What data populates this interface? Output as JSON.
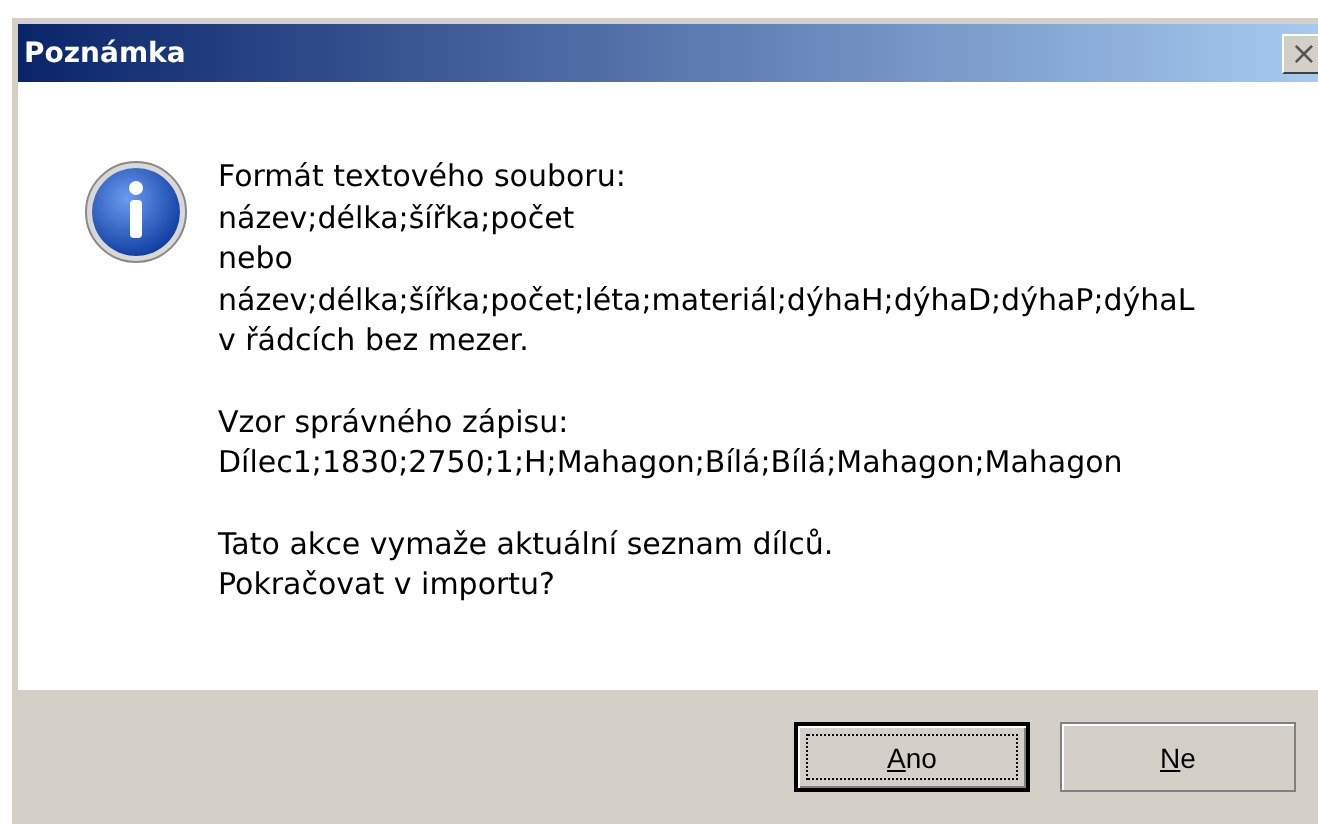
{
  "window": {
    "title": "Poznámka",
    "close_label": "×"
  },
  "message": [
    [
      "Formát textového souboru:",
      "název;délka;šířka;počet",
      "nebo",
      "název;délka;šířka;počet;léta;materiál;dýhaH;dýhaD;dýhaP;dýhaL",
      "v řádcích bez mezer."
    ],
    [
      "Vzor správného zápisu:",
      "Dílec1;1830;2750;1;H;Mahagon;Bílá;Bílá;Mahagon;Mahagon"
    ],
    [
      "Tato akce vymaže aktuální seznam dílců.",
      "Pokračovat v importu?"
    ]
  ],
  "buttons": [
    {
      "label": "Ano",
      "underline_first": true,
      "focused": true
    },
    {
      "label": "Ne",
      "underline_first": true,
      "focused": false
    }
  ]
}
